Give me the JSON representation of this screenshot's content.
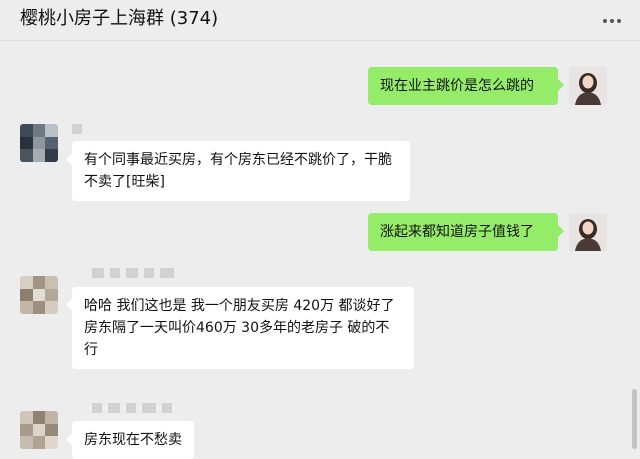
{
  "header": {
    "title": "樱桃小房子上海群 (374)",
    "more_icon": "more-dots-icon"
  },
  "messages": [
    {
      "side": "right",
      "text": "现在业主跳价是怎么跳的"
    },
    {
      "side": "left",
      "text": "有个同事最近买房，有个房东已经不跳价了，干脆不卖了[旺柴]"
    },
    {
      "side": "right",
      "text": "涨起来都知道房子值钱了"
    },
    {
      "side": "left",
      "text": "哈哈 我们这也是 我一个朋友买房 420万 都谈好了 房东隔了一天叫价460万 30多年的老房子 破的不行"
    },
    {
      "side": "left",
      "text": "房东现在不愁卖"
    }
  ],
  "colors": {
    "background": "#ededed",
    "bubble_self": "#95ec69",
    "bubble_other": "#ffffff"
  }
}
